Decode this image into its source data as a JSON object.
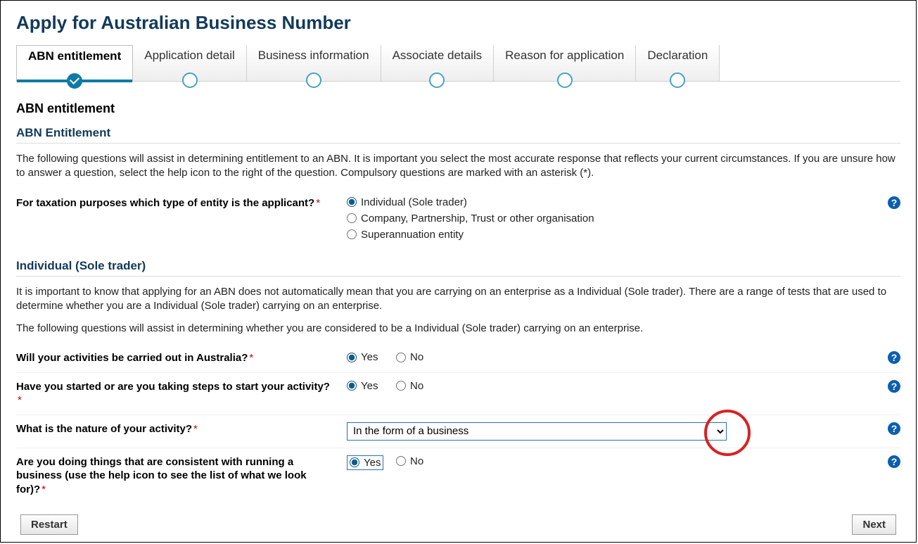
{
  "title": "Apply for Australian Business Number",
  "steps": [
    {
      "label": "ABN entitlement",
      "active": true
    },
    {
      "label": "Application detail",
      "active": false
    },
    {
      "label": "Business information",
      "active": false
    },
    {
      "label": "Associate details",
      "active": false
    },
    {
      "label": "Reason for application",
      "active": false
    },
    {
      "label": "Declaration",
      "active": false
    }
  ],
  "current_step_heading": "ABN entitlement",
  "section1": {
    "heading": "ABN Entitlement",
    "intro": "The following questions will assist in determining entitlement to an ABN. It is important you select the most accurate response that reflects your current circumstances. If you are unsure how to answer a question, select the help icon to the right of the question. Compulsory questions are marked with an asterisk (*).",
    "q_entity": {
      "label": "For taxation purposes which type of entity is the applicant?",
      "options": [
        "Individual (Sole trader)",
        "Company, Partnership, Trust or other organisation",
        "Superannuation entity"
      ],
      "selected": 0
    }
  },
  "section2": {
    "heading": "Individual (Sole trader)",
    "intro1": "It is important to know that applying for an ABN does not automatically mean that you are carrying on an enterprise as a Individual (Sole trader). There are a range of tests that are used to determine whether you are a Individual (Sole trader) carrying on an enterprise.",
    "intro2": "The following questions will assist in determining whether you are considered to be a Individual (Sole trader) carrying on an enterprise.",
    "q_australia": {
      "label": "Will your activities be carried out in Australia?",
      "yes": "Yes",
      "no": "No",
      "selected": "yes"
    },
    "q_started": {
      "label": "Have you started or are you taking steps to start your activity?",
      "yes": "Yes",
      "no": "No",
      "selected": "yes"
    },
    "q_nature": {
      "label": "What is the nature of your activity?",
      "value": "In the form of a business"
    },
    "q_running": {
      "label": "Are you doing things that are consistent with running a business (use the help icon to see the list of what we look for)?",
      "yes": "Yes",
      "no": "No",
      "selected": "yes"
    }
  },
  "buttons": {
    "restart": "Restart",
    "next": "Next"
  },
  "help_tooltip": "?"
}
